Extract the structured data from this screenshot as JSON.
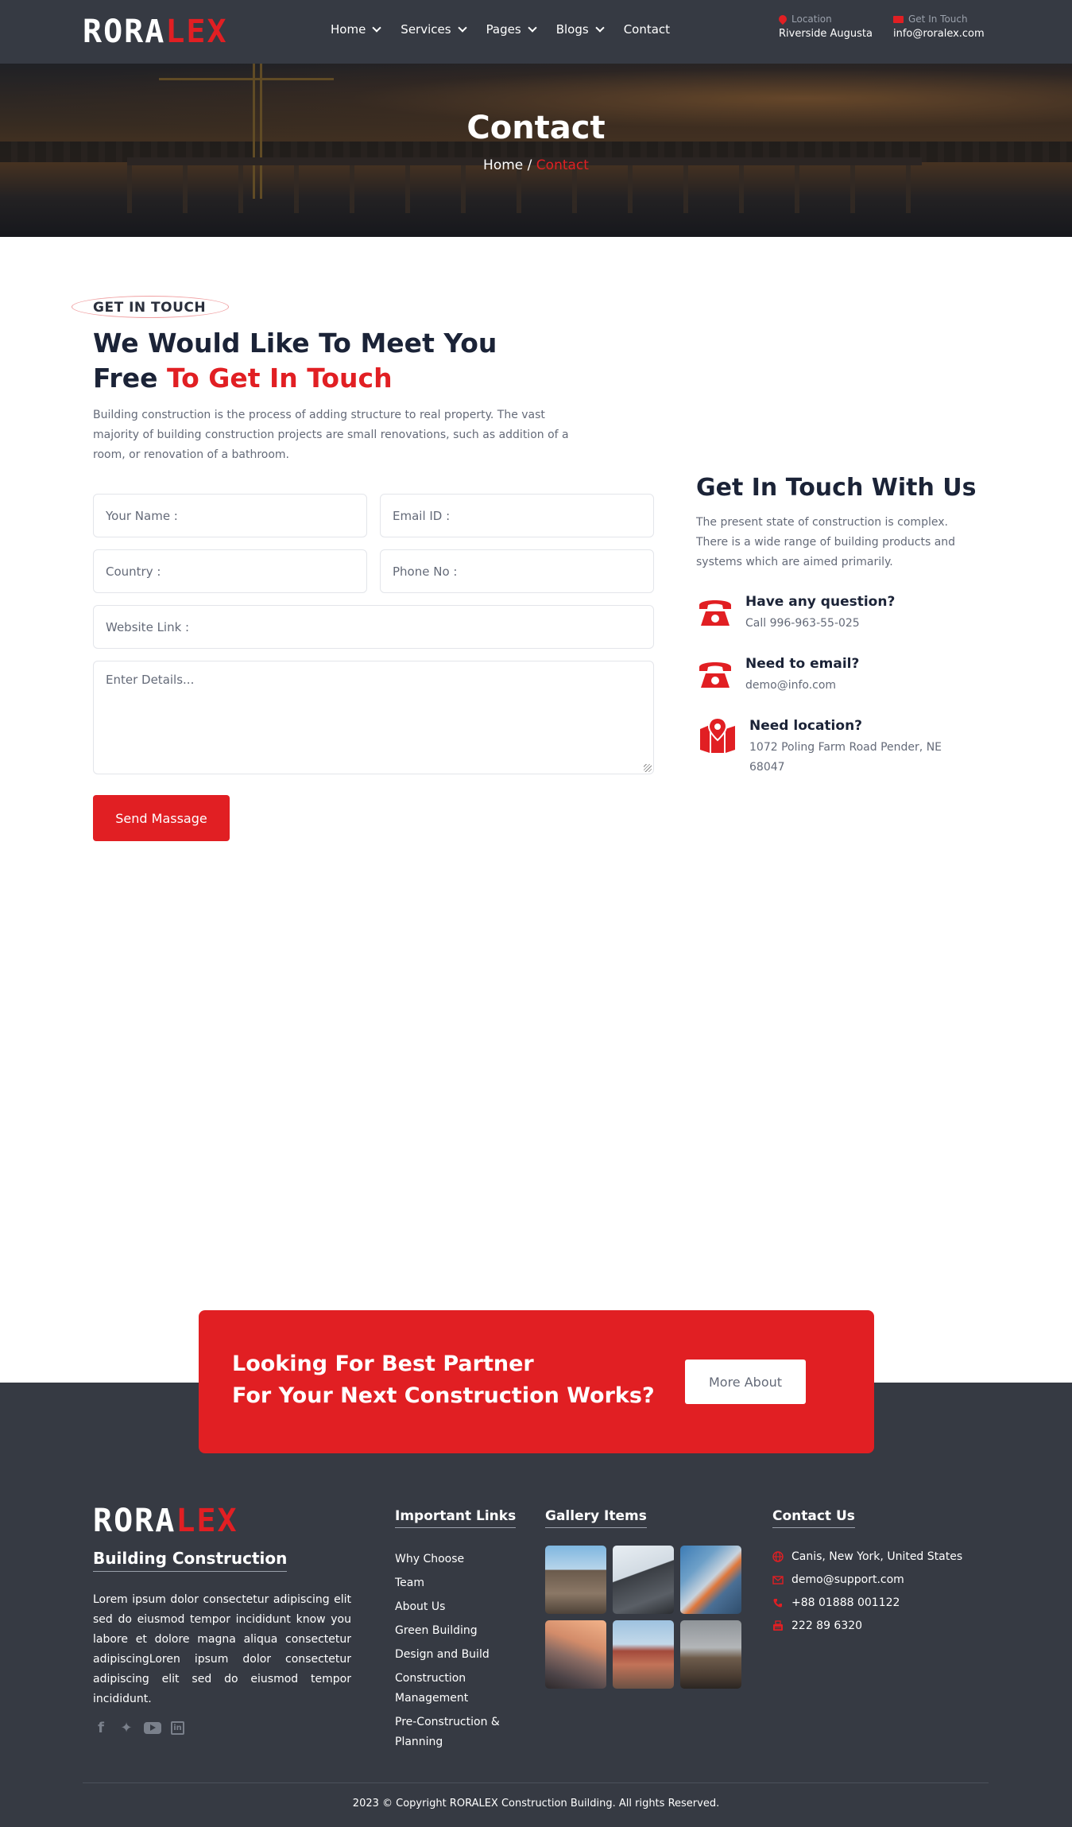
{
  "brand": {
    "logo_part1": "RORA",
    "logo_part2": "LEX"
  },
  "nav": {
    "items": [
      {
        "label": "Home",
        "has_menu": true
      },
      {
        "label": "Services",
        "has_menu": true
      },
      {
        "label": "Pages",
        "has_menu": true
      },
      {
        "label": "Blogs",
        "has_menu": true
      },
      {
        "label": "Contact",
        "has_menu": false
      }
    ]
  },
  "header_info": {
    "location_label": "Location",
    "location_value": "Riverside Augusta",
    "touch_label": "Get In Touch",
    "touch_value": "info@roralex.com"
  },
  "hero": {
    "title": "Contact",
    "breadcrumb_home": "Home",
    "breadcrumb_sep": "/",
    "breadcrumb_current": "Contact"
  },
  "contact_section": {
    "tag": "GET IN TOUCH",
    "heading_line1": "We Would Like To Meet You",
    "heading_line2_plain": "Free ",
    "heading_line2_red": "To Get In Touch",
    "intro": "Building construction is the process of adding structure to real property. The vast majority of building construction projects are small renovations, such as addition of a room, or renovation of a bathroom."
  },
  "form": {
    "name_placeholder": "Your Name :",
    "email_placeholder": "Email ID :",
    "country_placeholder": "Country :",
    "phone_placeholder": "Phone No :",
    "website_placeholder": "Website Link :",
    "details_placeholder": "Enter Details...",
    "submit_label": "Send Massage"
  },
  "touch_panel": {
    "title": "Get In Touch With Us",
    "description": "The present state of construction is complex. There is a wide range of building products and systems which are aimed primarily.",
    "items": [
      {
        "title": "Have any question?",
        "detail": "Call 996-963-55-025",
        "icon": "telephone-icon"
      },
      {
        "title": "Need to email?",
        "detail": "demo@info.com",
        "icon": "telephone-icon"
      },
      {
        "title": "Need location?",
        "detail": "1072 Poling Farm Road Pender, NE 68047",
        "icon": "map-pin-icon"
      }
    ]
  },
  "cta": {
    "line1": "Looking For Best Partner",
    "line2": "For Your Next Construction Works?",
    "button": "More About"
  },
  "footer": {
    "subtitle": "Building Construction",
    "about": "Lorem ipsum dolor consectetur adipiscing elit sed do eiusmod tempor incididunt know you labore et dolore magna aliqua consectetur adipiscingLoren ipsum dolor consectetur adipiscing elit sed do eiusmod tempor incididunt.",
    "social": [
      "facebook-icon",
      "twitter-icon",
      "youtube-icon",
      "linkedin-icon"
    ],
    "links_title": "Important Links",
    "links": [
      "Why Choose",
      "Team",
      "About Us",
      "Green Building",
      "Design and Build",
      "Construction Management",
      "Pre-Construction & Planning"
    ],
    "gallery_title": "Gallery Items",
    "contact_title": "Contact Us",
    "contacts": [
      {
        "icon": "globe-icon",
        "text": "Canis, New York, United States"
      },
      {
        "icon": "envelope-icon",
        "text": "demo@support.com"
      },
      {
        "icon": "phone-ring-icon",
        "text": "+88 01888 001122"
      },
      {
        "icon": "fax-icon",
        "text": "222 89 6320"
      }
    ],
    "copyright": "2023 © Copyright RORALEX Construction Building. All rights Reserved."
  },
  "colors": {
    "accent": "#e11f23",
    "dark": "#363a43",
    "heading": "#1b2337",
    "text": "#646a78"
  }
}
